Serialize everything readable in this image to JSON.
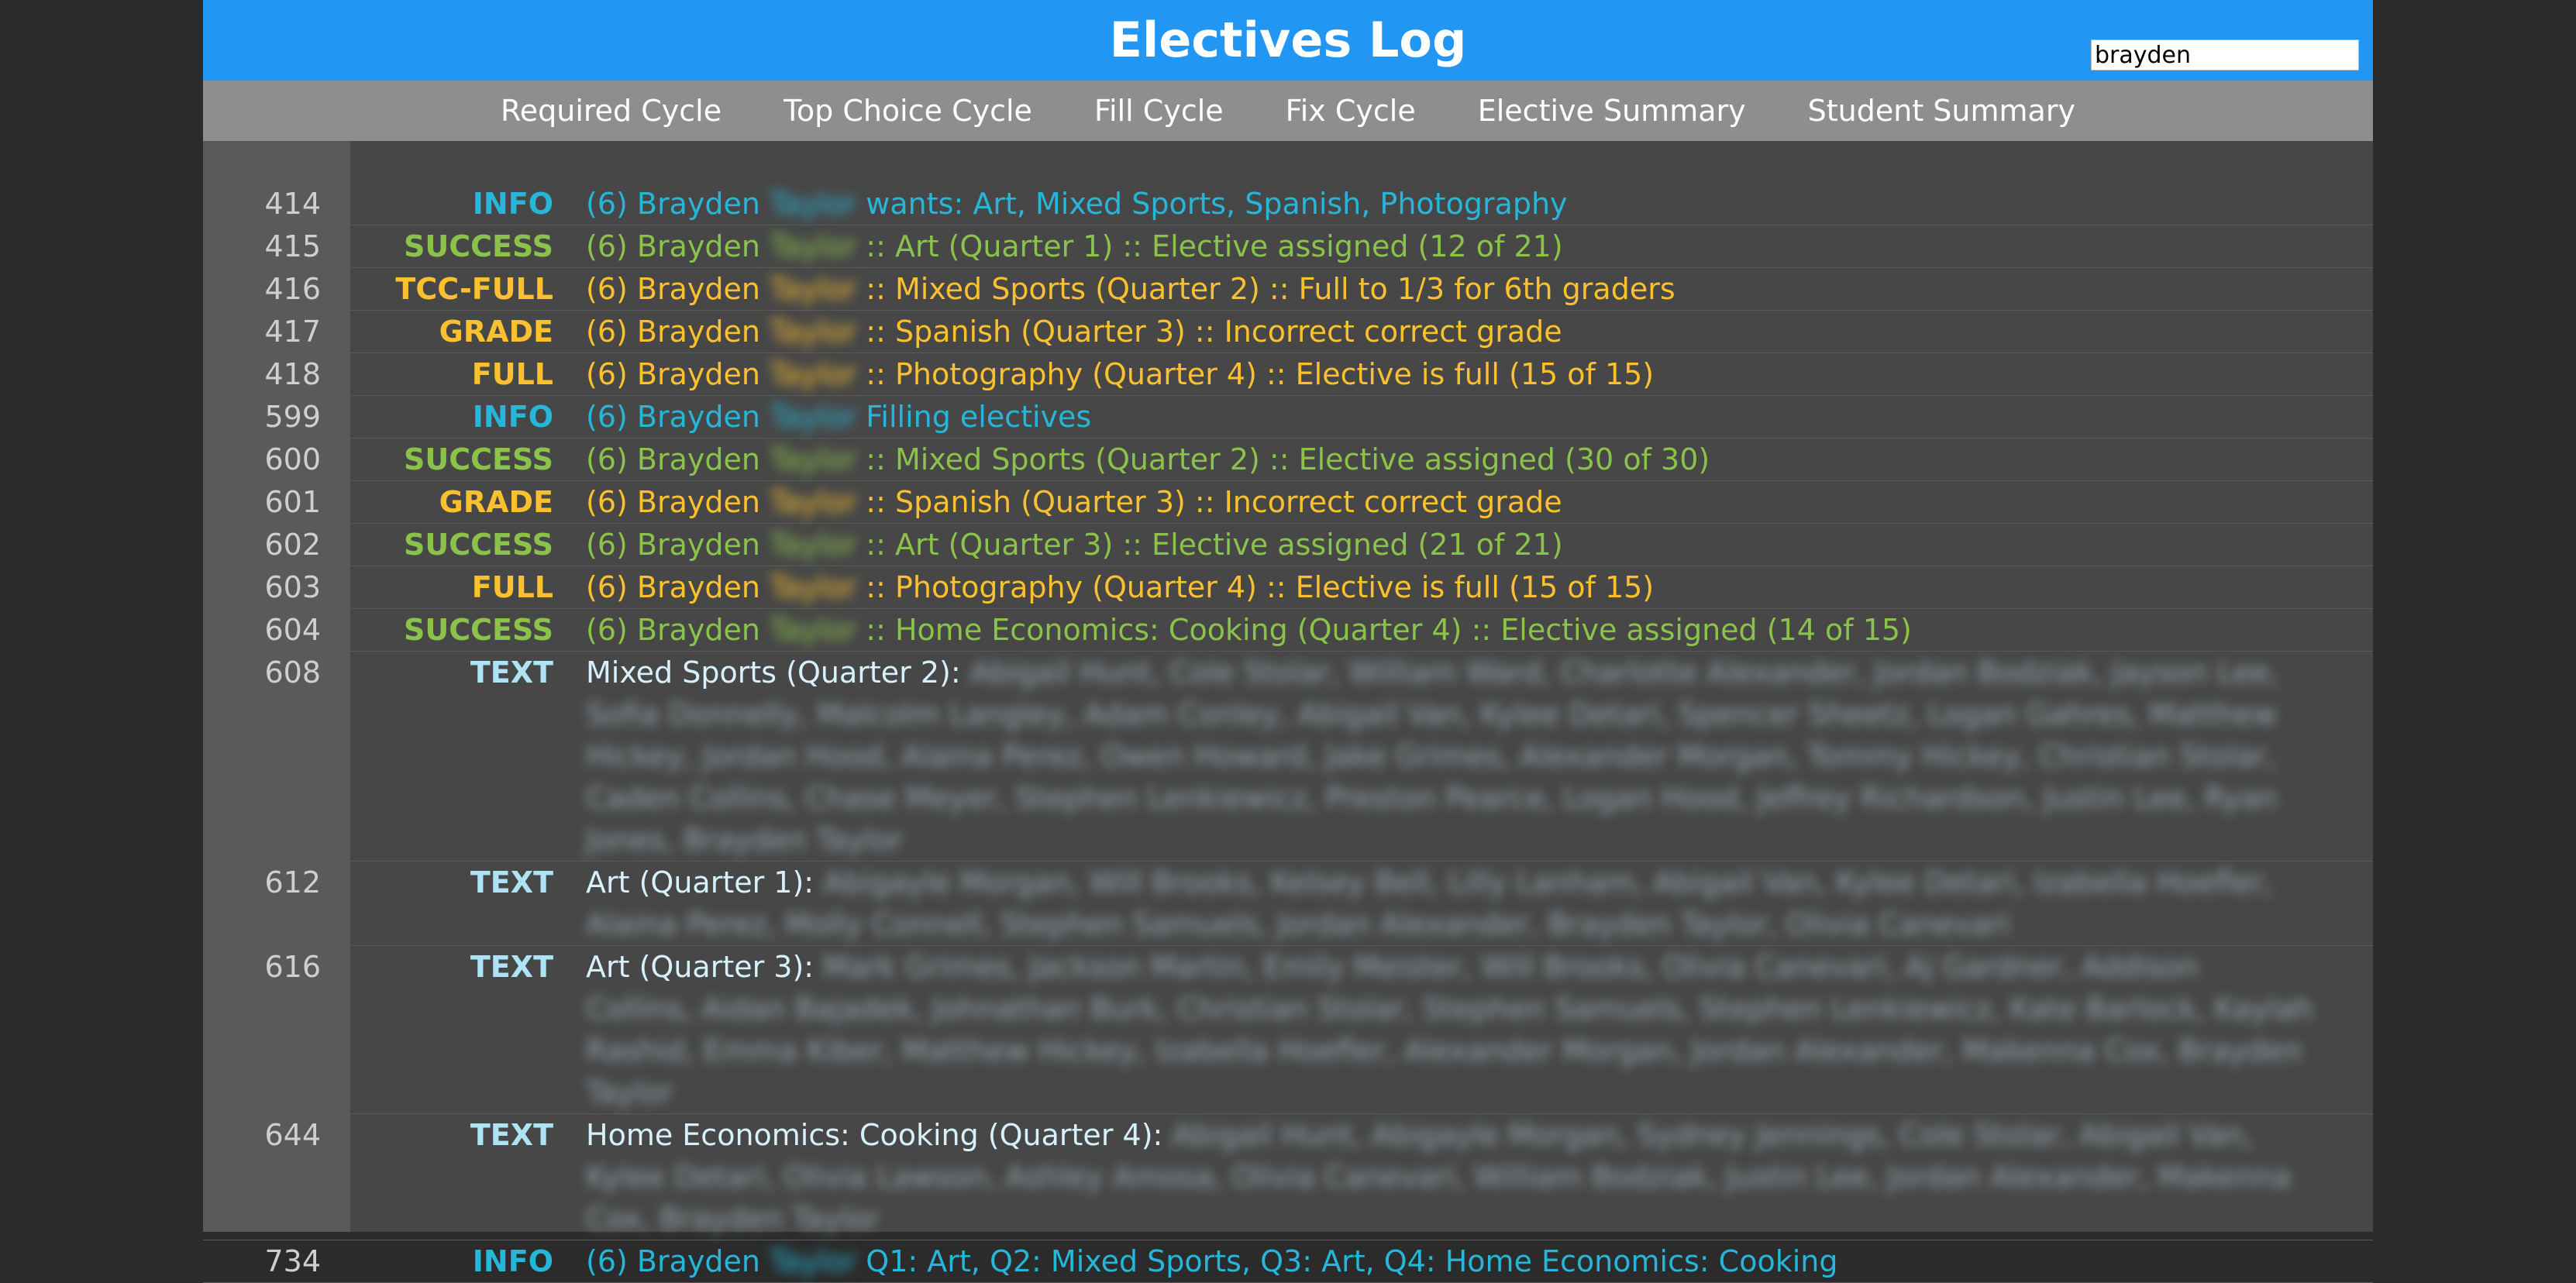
{
  "header": {
    "title": "Electives Log"
  },
  "search": {
    "value": "brayden"
  },
  "nav": [
    "Required Cycle",
    "Top Choice Cycle",
    "Fill Cycle",
    "Fix Cycle",
    "Elective Summary",
    "Student Summary"
  ],
  "colors": {
    "header": "#2196f3",
    "nav": "#8e8e8e",
    "info": "#26b6d9",
    "success": "#8bc34a",
    "warning": "#fbc02d",
    "text": "#aee2f5"
  },
  "log": [
    {
      "line": "414",
      "level": "INFO",
      "kind": "info",
      "prefix": "(6) Brayden",
      "blurred": "Taylor",
      "text": "wants: Art, Mixed Sports, Spanish, Photography"
    },
    {
      "line": "415",
      "level": "SUCCESS",
      "kind": "success",
      "prefix": "(6) Brayden",
      "blurred": "Taylor",
      "text": ":: Art (Quarter 1) :: Elective assigned (12 of 21)"
    },
    {
      "line": "416",
      "level": "TCC-FULL",
      "kind": "warn",
      "prefix": "(6) Brayden",
      "blurred": "Taylor",
      "text": ":: Mixed Sports (Quarter 2) :: Full to 1/3 for 6th graders"
    },
    {
      "line": "417",
      "level": "GRADE",
      "kind": "warn",
      "prefix": "(6) Brayden",
      "blurred": "Taylor",
      "text": ":: Spanish (Quarter 3) :: Incorrect correct grade"
    },
    {
      "line": "418",
      "level": "FULL",
      "kind": "warn",
      "prefix": "(6) Brayden",
      "blurred": "Taylor",
      "text": ":: Photography (Quarter 4) :: Elective is full (15 of 15)"
    },
    {
      "line": "599",
      "level": "INFO",
      "kind": "info",
      "prefix": "(6) Brayden",
      "blurred": "Taylor",
      "text": "Filling electives"
    },
    {
      "line": "600",
      "level": "SUCCESS",
      "kind": "success",
      "prefix": "(6) Brayden",
      "blurred": "Taylor",
      "text": ":: Mixed Sports (Quarter 2) :: Elective assigned (30 of 30)"
    },
    {
      "line": "601",
      "level": "GRADE",
      "kind": "warn",
      "prefix": "(6) Brayden",
      "blurred": "Taylor",
      "text": ":: Spanish (Quarter 3) :: Incorrect correct grade"
    },
    {
      "line": "602",
      "level": "SUCCESS",
      "kind": "success",
      "prefix": "(6) Brayden",
      "blurred": "Taylor",
      "text": ":: Art (Quarter 3) :: Elective assigned (21 of 21)"
    },
    {
      "line": "603",
      "level": "FULL",
      "kind": "warn",
      "prefix": "(6) Brayden",
      "blurred": "Taylor",
      "text": ":: Photography (Quarter 4) :: Elective is full (15 of 15)"
    },
    {
      "line": "604",
      "level": "SUCCESS",
      "kind": "success",
      "prefix": "(6) Brayden",
      "blurred": "Taylor",
      "text": ":: Home Economics: Cooking (Quarter 4) :: Elective assigned (14 of 15)"
    },
    {
      "line": "608",
      "level": "TEXT",
      "kind": "text",
      "prefix": "Mixed Sports (Quarter 2):",
      "blurred": "Abigail Hunt, Cole Stolar, William Ward, Charlotte Alexander, Jordan Bodziak, Jayson Lee, Sofia Donnelly, Malcolm Langley, Adam Conley, Abigail Van, Kylee Detari, Spencer Sheetz, Logan Gahres, Matthew Hickey, Jordan Hood, Alaina Perez, Owen Howard, Jake Grimes, Alexander Morgan, Tommy Hickey, Christian Stolar, Caden Collins, Chase Meyer, Stephen Lenkiewicz, Preston Pearce, Logan Hood, Jeffrey Richardson, Justin Lee, Ryan Jones, Brayden Taylor",
      "text": ""
    },
    {
      "line": "612",
      "level": "TEXT",
      "kind": "text",
      "prefix": "Art (Quarter 1):",
      "blurred": "Abigayle Morgan, Will Brooks, Kelsey Bell, Lilly Lanham, Abigail Van, Kylee Detari, Izabella Hoefler, Alaina Perez, Molly Connell, Stephen Samuels, Jordan Alexander, Brayden Taylor, Olivia Canevari",
      "text": ""
    },
    {
      "line": "616",
      "level": "TEXT",
      "kind": "text",
      "prefix": "Art (Quarter 3):",
      "blurred": "Mark Grimes, Jackson Martin, Emily Meister, Will Brooks, Olivia Canevari, Aj Gardner, Addison Collins, Aidan Bajadek, Johnathan Burk, Christian Stolar, Stephen Samuels, Stephen Lenkiewicz, Kate Barlock, Kaylah Rashid, Emma Kiber, Matthew Hickey, Izabella Hoefler, Alexander Morgan, Jordan Alexander, Makenna Cox, Brayden Taylor",
      "text": ""
    },
    {
      "line": "644",
      "level": "TEXT",
      "kind": "text",
      "prefix": "Home Economics: Cooking (Quarter 4):",
      "blurred": "Abigail Hunt, Abigayle Morgan, Sydney Jennings, Cole Stolar, Abigail Van, Kylee Detari, Olivia Lawson, Ashley Amosa, Olivia Canevari, William Bodziak, Justin Lee, Jordan Alexander, Makenna Cox, Brayden Taylor",
      "text": ""
    },
    {
      "line": "734",
      "level": "INFO",
      "kind": "info",
      "prefix": "(6) Brayden",
      "blurred": "Taylor",
      "text": "Q1: Art, Q2: Mixed Sports, Q3: Art, Q4: Home Economics: Cooking"
    }
  ]
}
